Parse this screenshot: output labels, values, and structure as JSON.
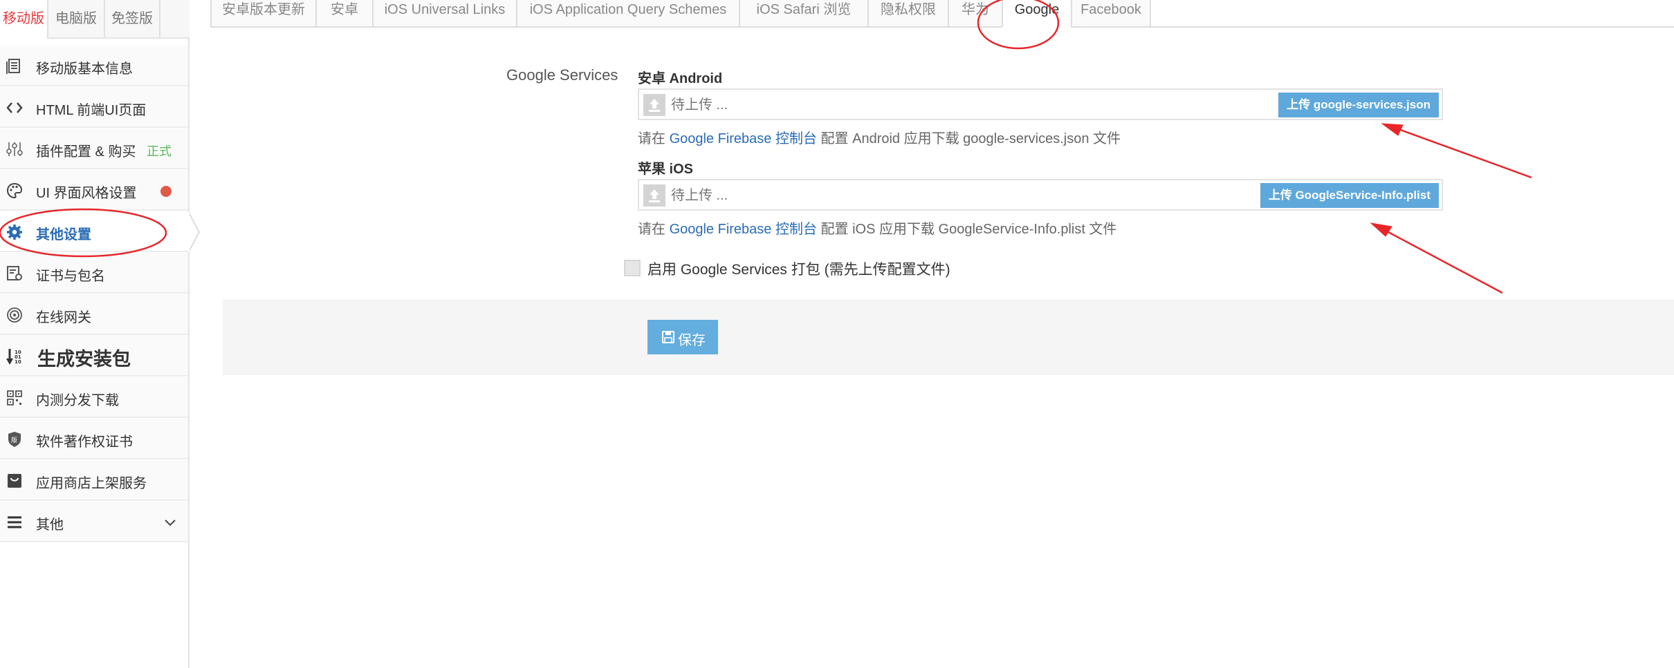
{
  "sidebar": {
    "tabs": [
      {
        "label": "移动版",
        "active": true
      },
      {
        "label": "电脑版",
        "active": false
      },
      {
        "label": "免签版",
        "active": false
      }
    ],
    "items": [
      {
        "label": "移动版基本信息",
        "icon": "document-list-icon"
      },
      {
        "label": "HTML 前端UI页面",
        "icon": "code-icon"
      },
      {
        "label": "插件配置 & 购买",
        "icon": "sliders-icon",
        "badge": "正式"
      },
      {
        "label": "UI 界面风格设置",
        "icon": "palette-icon",
        "dot_color": "#e05a4a"
      },
      {
        "label": "其他设置",
        "icon": "gear-icon",
        "active": true
      },
      {
        "label": "证书与包名",
        "icon": "certificate-icon"
      },
      {
        "label": "在线网关",
        "icon": "network-icon"
      },
      {
        "label": "生成安装包",
        "icon": "binary-sort-icon"
      },
      {
        "label": "内测分发下载",
        "icon": "qrcode-icon"
      },
      {
        "label": "软件著作权证书",
        "icon": "copyright-shield-icon"
      },
      {
        "label": "应用商店上架服务",
        "icon": "store-bag-icon"
      },
      {
        "label": "其他",
        "icon": "menu-icon"
      }
    ]
  },
  "tabs": [
    {
      "label": "安卓版本更新"
    },
    {
      "label": "安卓"
    },
    {
      "label": "iOS Universal Links"
    },
    {
      "label": "iOS Application Query Schemes"
    },
    {
      "label": "iOS Safari 浏览"
    },
    {
      "label": "隐私权限"
    },
    {
      "label": "华为"
    },
    {
      "label": "Google",
      "active": true
    },
    {
      "label": "Facebook"
    }
  ],
  "form": {
    "section_label": "Google Services",
    "android": {
      "label": "安卓 Android",
      "placeholder": "待上传 ...",
      "button": "上传 google-services.json",
      "help_prefix": "请在",
      "help_link": "Google Firebase 控制台",
      "help_suffix": "配置 Android 应用下载 google-services.json 文件"
    },
    "ios": {
      "label": "苹果 iOS",
      "placeholder": "待上传 ...",
      "button": "上传 GoogleService-Info.plist",
      "help_prefix": "请在",
      "help_link": "Google Firebase 控制台",
      "help_suffix": "配置 iOS 应用下载 GoogleService-Info.plist 文件"
    },
    "enable_checkbox": {
      "label": "启用 Google Services 打包 (需先上传配置文件)",
      "checked": false
    },
    "save_label": "保存"
  },
  "colors": {
    "accent_red": "#e4393c",
    "link_blue": "#2a6cb5",
    "button_blue": "#5fa8dc",
    "success_green": "#5cb85c",
    "annotation_red": "#e8262a"
  }
}
